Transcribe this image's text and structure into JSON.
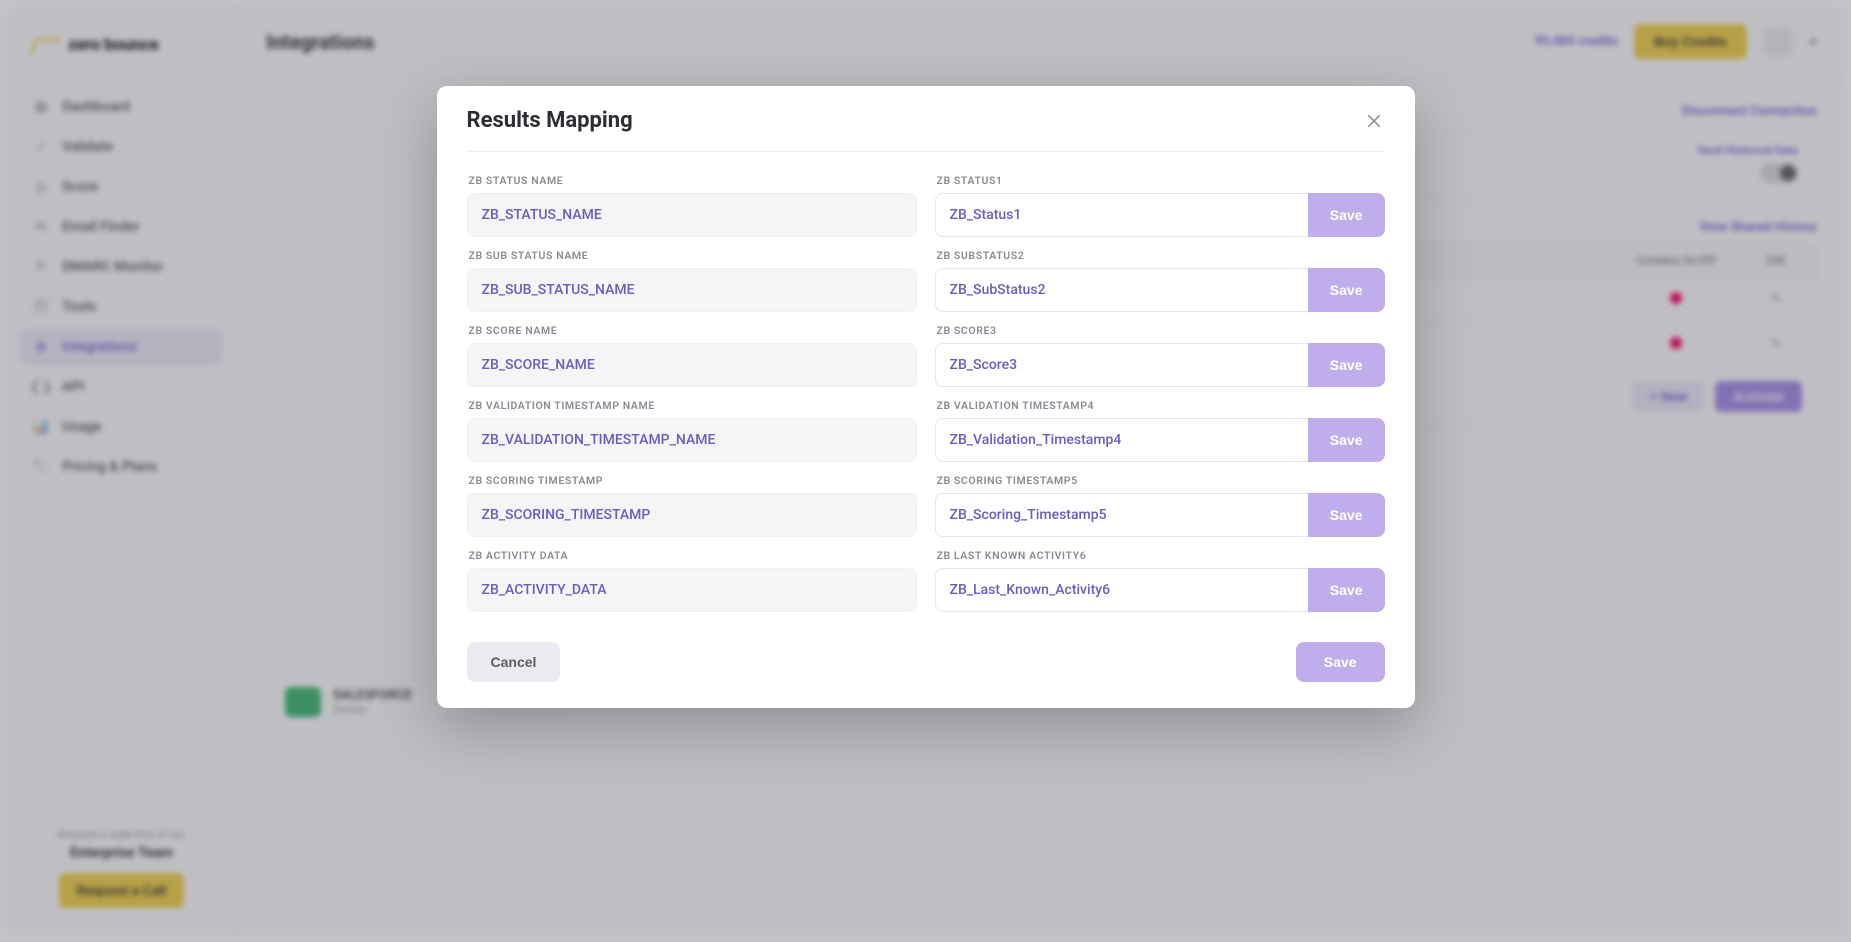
{
  "brand": {
    "name": "zero bounce"
  },
  "sidebar": {
    "items": [
      {
        "label": "Dashboard"
      },
      {
        "label": "Validate"
      },
      {
        "label": "Score"
      },
      {
        "label": "Email Finder"
      },
      {
        "label": "DMARC Monitor"
      },
      {
        "label": "Tools"
      },
      {
        "label": "Integrations"
      },
      {
        "label": "API"
      },
      {
        "label": "Usage"
      },
      {
        "label": "Pricing & Plans"
      }
    ],
    "footer_hint": "Request a walk-thru of our",
    "footer_team": "Enterprise Team",
    "footer_cta": "Request a Call"
  },
  "topbar": {
    "title": "Integrations",
    "credits": "99,484 credits",
    "buy": "Buy Credits"
  },
  "right_panel": {
    "disconnect": "Disconnect Connection",
    "toggle_label": "Send Historical Data",
    "history": "View Shared History",
    "col_status": "Contains On/Off",
    "col_edit": "Edit",
    "btn_new": "+ New",
    "btn_map": "Activate"
  },
  "integration_card": {
    "name": "SALESFORCE",
    "sub": "Details"
  },
  "modal": {
    "title": "Results Mapping",
    "save": "Save",
    "cancel": "Cancel",
    "save_main": "Save",
    "rows": [
      {
        "l_label": "ZB STATUS NAME",
        "l_value": "ZB_STATUS_NAME",
        "r_label": "ZB STATUS1",
        "r_value": "ZB_Status1"
      },
      {
        "l_label": "ZB SUB STATUS NAME",
        "l_value": "ZB_SUB_STATUS_NAME",
        "r_label": "ZB SUBSTATUS2",
        "r_value": "ZB_SubStatus2"
      },
      {
        "l_label": "ZB SCORE NAME",
        "l_value": "ZB_SCORE_NAME",
        "r_label": "ZB SCORE3",
        "r_value": "ZB_Score3"
      },
      {
        "l_label": "ZB VALIDATION TIMESTAMP NAME",
        "l_value": "ZB_VALIDATION_TIMESTAMP_NAME",
        "r_label": "ZB VALIDATION TIMESTAMP4",
        "r_value": "ZB_Validation_Timestamp4"
      },
      {
        "l_label": "ZB SCORING TIMESTAMP",
        "l_value": "ZB_SCORING_TIMESTAMP",
        "r_label": "ZB SCORING TIMESTAMP5",
        "r_value": "ZB_Scoring_Timestamp5"
      },
      {
        "l_label": "ZB ACTIVITY DATA",
        "l_value": "ZB_ACTIVITY_DATA",
        "r_label": "ZB LAST KNOWN ACTIVITY6",
        "r_value": "ZB_Last_Known_Activity6"
      }
    ]
  }
}
